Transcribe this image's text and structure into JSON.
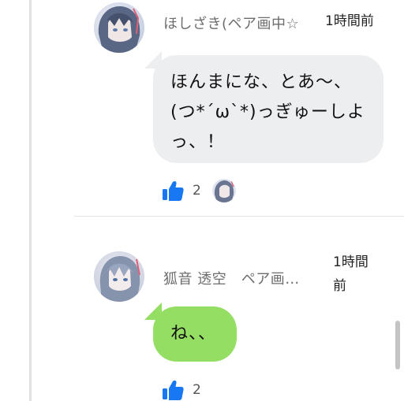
{
  "comments": [
    {
      "author": "ほしざき(ペア画中☆",
      "time": "1時間前",
      "message": "ほんまにな、とあ〜、\n(つ*´ω`*)っぎゅーしよ\nっ、！",
      "likes": "2",
      "avatar_icon": "anime-avatar-icon",
      "bubble_color": "#edeef0"
    },
    {
      "author": "狐音 透空　ペア画…",
      "time": "1時間\n前",
      "message": "ね、、",
      "likes": "2",
      "avatar_icon": "anime-avatar-icon",
      "bubble_color": "#95de64"
    }
  ],
  "colors": {
    "like_blue": "#1877f2",
    "gray_bubble": "#edeef0",
    "green_bubble": "#95de64"
  },
  "icons": {
    "like": "thumbs-up-icon",
    "liker_avatar": "liker-avatar-icon"
  }
}
